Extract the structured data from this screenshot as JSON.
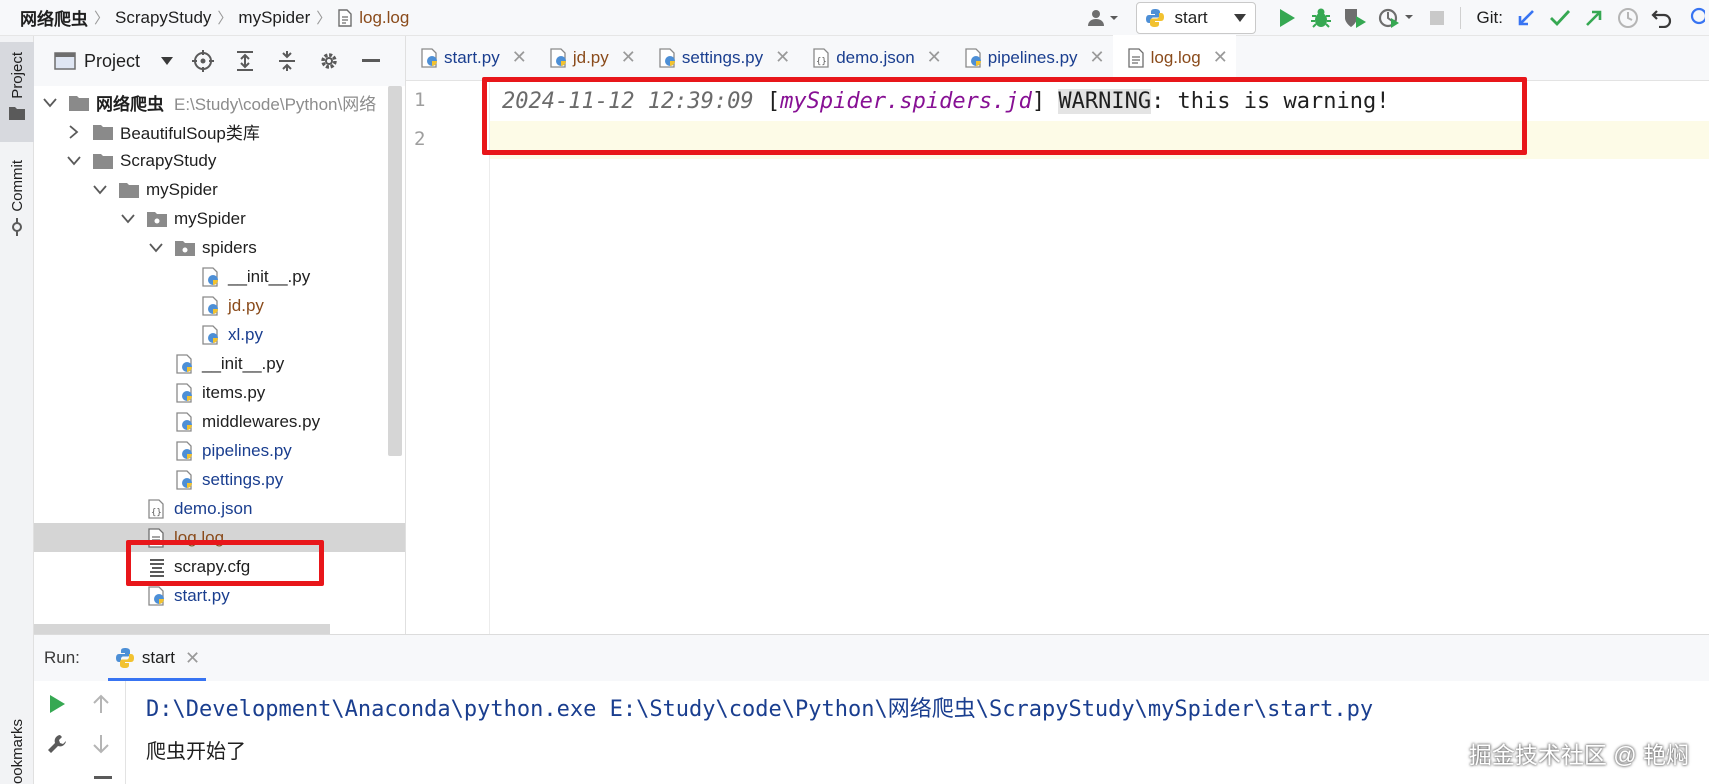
{
  "breadcrumb": {
    "items": [
      "网络爬虫",
      "ScrapyStudy",
      "mySpider",
      "log.log"
    ]
  },
  "toolbar": {
    "run_config": "start",
    "git_label": "Git:"
  },
  "left_strip": {
    "project_tab": "Project",
    "commit_tab": "Commit",
    "bookmarks_tab": "ookmarks"
  },
  "project": {
    "title": "Project",
    "root_name": "网络爬虫",
    "root_path": "E:\\Study\\code\\Python\\网络",
    "items": [
      {
        "label": "BeautifulSoup类库"
      },
      {
        "label": "ScrapyStudy"
      },
      {
        "label": "mySpider"
      },
      {
        "label": "mySpider"
      },
      {
        "label": "spiders"
      },
      {
        "label": "__init__.py"
      },
      {
        "label": "jd.py"
      },
      {
        "label": "xl.py"
      },
      {
        "label": "__init__.py"
      },
      {
        "label": "items.py"
      },
      {
        "label": "middlewares.py"
      },
      {
        "label": "pipelines.py"
      },
      {
        "label": "settings.py"
      },
      {
        "label": "demo.json"
      },
      {
        "label": "log.log"
      },
      {
        "label": "scrapy.cfg"
      },
      {
        "label": "start.py"
      }
    ]
  },
  "tabs": [
    {
      "label": "start.py"
    },
    {
      "label": "jd.py"
    },
    {
      "label": "settings.py"
    },
    {
      "label": "demo.json"
    },
    {
      "label": "pipelines.py"
    },
    {
      "label": "log.log"
    }
  ],
  "editor": {
    "line_numbers": [
      "1",
      "2"
    ],
    "log": {
      "timestamp": "2024-11-12 12:39:09",
      "open_bracket": "[",
      "logger": "mySpider.spiders.jd",
      "close_bracket": "]",
      "level": "WARNING",
      "message": ": this is warning!"
    }
  },
  "run": {
    "label": "Run:",
    "tab": "start",
    "command": "D:\\Development\\Anaconda\\python.exe E:\\Study\\code\\Python\\网络爬虫\\ScrapyStudy\\mySpider\\start.py",
    "output": "爬虫开始了"
  },
  "watermark": "掘金技术社区 @ 艳焖",
  "colors": {
    "highlight_box": "#e8161a",
    "accent": "#3874f2",
    "run_green": "#36a852"
  }
}
